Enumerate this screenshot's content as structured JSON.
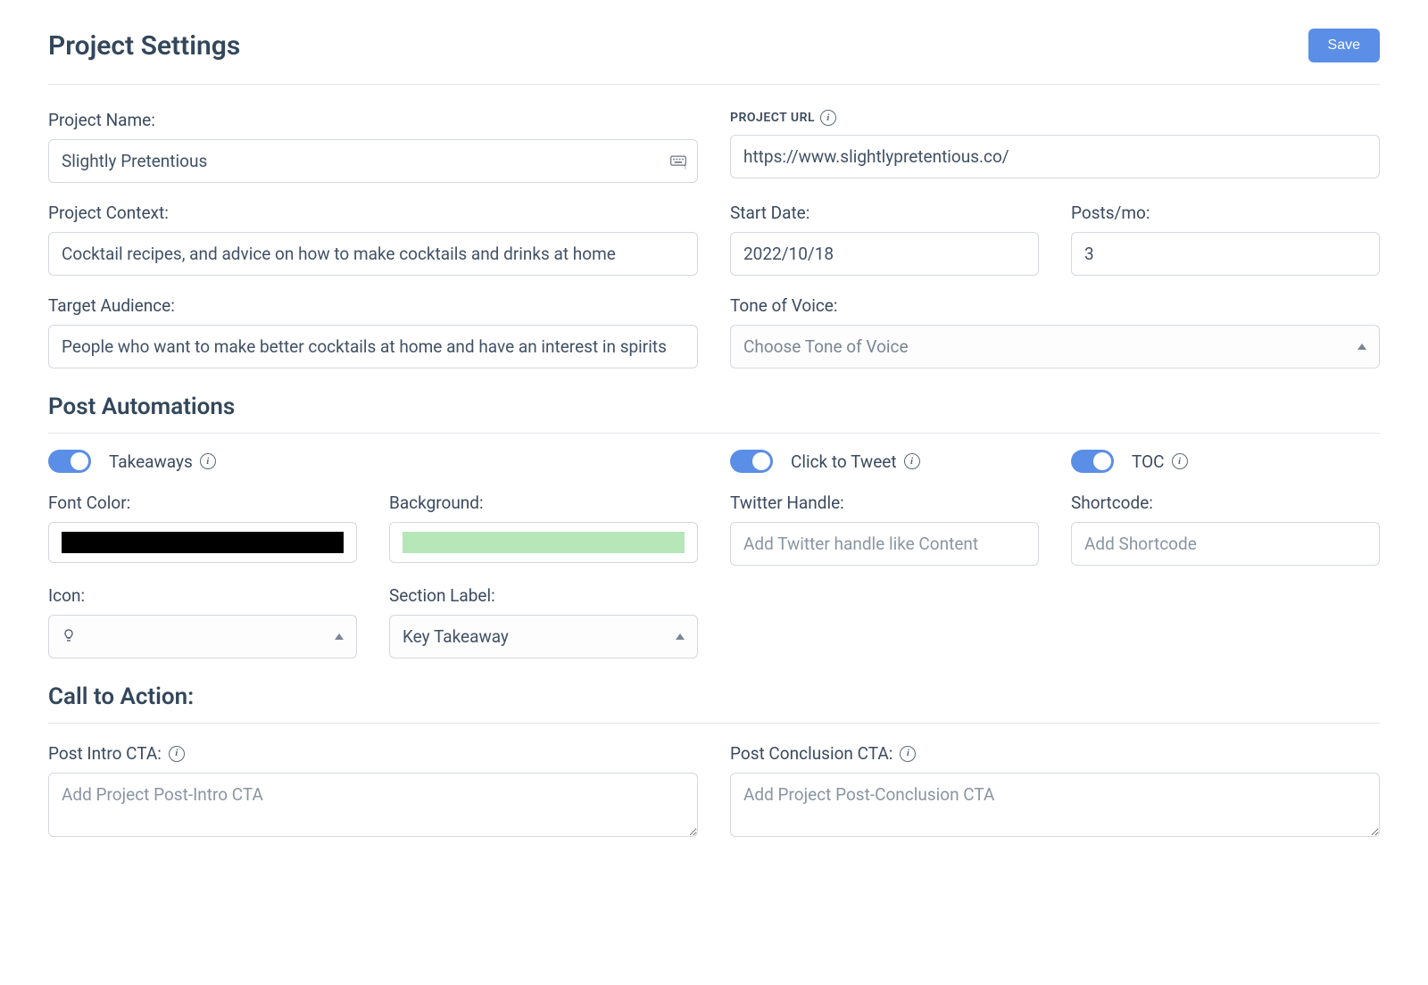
{
  "header": {
    "title": "Project Settings",
    "save_label": "Save"
  },
  "project": {
    "name_label": "Project Name:",
    "name_value": "Slightly Pretentious",
    "url_label": "PROJECT URL",
    "url_value": "https://www.slightlypretentious.co/",
    "context_label": "Project Context:",
    "context_value": "Cocktail recipes, and advice on how to make cocktails and drinks at home",
    "start_date_label": "Start Date:",
    "start_date_value": "2022/10/18",
    "posts_per_mo_label": "Posts/mo:",
    "posts_per_mo_value": "3",
    "audience_label": "Target Audience:",
    "audience_value": "People who want to make better cocktails at home and have an interest in spirits",
    "tone_label": "Tone of Voice:",
    "tone_placeholder": "Choose Tone of Voice"
  },
  "automations": {
    "heading": "Post Automations",
    "takeaways_label": "Takeaways",
    "click_to_tweet_label": "Click to Tweet",
    "toc_label": "TOC",
    "font_color_label": "Font Color:",
    "font_color_value": "#000000",
    "background_label": "Background:",
    "background_value": "#b7e7b8",
    "twitter_label": "Twitter Handle:",
    "twitter_placeholder": "Add Twitter handle like Content",
    "shortcode_label": "Shortcode:",
    "shortcode_placeholder": "Add Shortcode",
    "icon_label": "Icon:",
    "icon_value": "lightbulb",
    "section_label_label": "Section Label:",
    "section_label_value": "Key Takeaway"
  },
  "cta": {
    "heading": "Call to Action:",
    "intro_label": "Post Intro CTA:",
    "intro_placeholder": "Add Project Post-Intro CTA",
    "conclusion_label": "Post Conclusion CTA:",
    "conclusion_placeholder": "Add Project Post-Conclusion CTA"
  }
}
